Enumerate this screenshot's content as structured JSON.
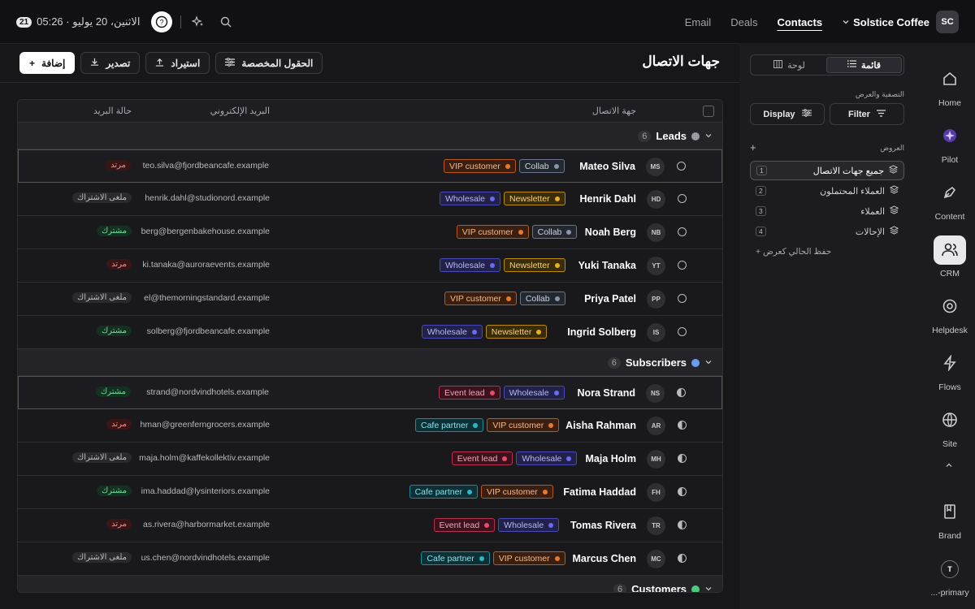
{
  "topbar": {
    "notif_count": "21",
    "date": "الاثنين، 20 يوليو · 05:26",
    "nav": [
      "Email",
      "Deals",
      "Contacts"
    ],
    "active": "Contacts",
    "workspace": "Solstice Coffee",
    "avatar": "SC"
  },
  "header": {
    "title": "جهات الاتصال",
    "add": "إضافة",
    "export": "تصدير",
    "import": "استيراد",
    "custom_fields": "الحقول المخصصة"
  },
  "table": {
    "col_contact": "جهة الاتصال",
    "col_email": "البريد الإلكتروني",
    "col_mail_status": "حالة البريد"
  },
  "groups": [
    {
      "label": "Leads",
      "count": "6",
      "color": "#9a9aa0",
      "rows": [
        {
          "initials": "MS",
          "name": "Mateo Silva",
          "tags": [
            {
              "t": "VIP customer",
              "k": "vip"
            },
            {
              "t": "Collab",
              "k": "collab"
            }
          ],
          "email": "teo.silva@fjordbeancafe.example",
          "mail": "مرتد",
          "mk": "bounced",
          "sel": true
        },
        {
          "initials": "HD",
          "name": "Henrik Dahl",
          "tags": [
            {
              "t": "Wholesale",
              "k": "wh"
            },
            {
              "t": "Newsletter",
              "k": "news"
            }
          ],
          "email": "henrik.dahl@studionord.example",
          "mail": "ملغى الاشتراك",
          "mk": "unsub"
        },
        {
          "initials": "NB",
          "name": "Noah Berg",
          "tags": [
            {
              "t": "VIP customer",
              "k": "vip"
            },
            {
              "t": "Collab",
              "k": "collab"
            }
          ],
          "email": "berg@bergenbakehouse.example",
          "mail": "مشترك",
          "mk": "sub"
        },
        {
          "initials": "YT",
          "name": "Yuki Tanaka",
          "tags": [
            {
              "t": "Wholesale",
              "k": "wh"
            },
            {
              "t": "Newsletter",
              "k": "news"
            }
          ],
          "email": "ki.tanaka@auroraevents.example",
          "mail": "مرتد",
          "mk": "bounced"
        },
        {
          "initials": "PP",
          "name": "Priya Patel",
          "tags": [
            {
              "t": "VIP customer",
              "k": "vip"
            },
            {
              "t": "Collab",
              "k": "collab"
            }
          ],
          "email": "el@themorningstandard.example",
          "mail": "ملغى الاشتراك",
          "mk": "unsub"
        },
        {
          "initials": "IS",
          "name": "Ingrid Solberg",
          "tags": [
            {
              "t": "Wholesale",
              "k": "wh"
            },
            {
              "t": "Newsletter",
              "k": "news"
            }
          ],
          "email": "solberg@fjordbeancafe.example",
          "mail": "مشترك",
          "mk": "sub"
        }
      ]
    },
    {
      "label": "Subscribers",
      "count": "6",
      "color": "#6a9cf0",
      "half": true,
      "rows": [
        {
          "initials": "NS",
          "name": "Nora Strand",
          "tags": [
            {
              "t": "Event lead",
              "k": "ev"
            },
            {
              "t": "Wholesale",
              "k": "wh"
            }
          ],
          "email": "strand@nordvindhotels.example",
          "mail": "مشترك",
          "mk": "sub",
          "sel": true
        },
        {
          "initials": "AR",
          "name": "Aisha Rahman",
          "tags": [
            {
              "t": "Cafe partner",
              "k": "cafe"
            },
            {
              "t": "VIP customer",
              "k": "vip"
            }
          ],
          "email": "hman@greenferngrocers.example",
          "mail": "مرتد",
          "mk": "bounced"
        },
        {
          "initials": "MH",
          "name": "Maja Holm",
          "tags": [
            {
              "t": "Event lead",
              "k": "ev"
            },
            {
              "t": "Wholesale",
              "k": "wh"
            }
          ],
          "email": "maja.holm@kaffekollektiv.example",
          "mail": "ملغى الاشتراك",
          "mk": "unsub"
        },
        {
          "initials": "FH",
          "name": "Fatima Haddad",
          "tags": [
            {
              "t": "Cafe partner",
              "k": "cafe"
            },
            {
              "t": "VIP customer",
              "k": "vip"
            }
          ],
          "email": "ima.haddad@lysinteriors.example",
          "mail": "مشترك",
          "mk": "sub"
        },
        {
          "initials": "TR",
          "name": "Tomas Rivera",
          "tags": [
            {
              "t": "Event lead",
              "k": "ev"
            },
            {
              "t": "Wholesale",
              "k": "wh"
            }
          ],
          "email": "as.rivera@harbormarket.example",
          "mail": "مرتد",
          "mk": "bounced"
        },
        {
          "initials": "MC",
          "name": "Marcus Chen",
          "tags": [
            {
              "t": "Cafe partner",
              "k": "cafe"
            },
            {
              "t": "VIP customer",
              "k": "vip"
            }
          ],
          "email": "us.chen@nordvindhotels.example",
          "mail": "ملغى الاشتراك",
          "mk": "unsub"
        }
      ]
    },
    {
      "label": "Customers",
      "count": "6",
      "color": "#4cc97a",
      "rows": []
    }
  ],
  "sidebar": {
    "list": "قائمة",
    "board": "لوحة",
    "filter_label": "التصفية والعرض",
    "filter": "Filter",
    "display": "Display",
    "views_label": "العروض",
    "views": [
      {
        "label": "جميع جهات الاتصال",
        "n": "1"
      },
      {
        "label": "العملاء المحتملون",
        "n": "2"
      },
      {
        "label": "العملاء",
        "n": "3"
      },
      {
        "label": "الإحالات",
        "n": "4"
      }
    ],
    "save_view": "+ حفظ الحالي كعرض"
  },
  "rail": [
    "Home",
    "Pilot",
    "Content",
    "CRM",
    "Helpdesk",
    "Flows",
    "Site",
    "Brand",
    "...-primary"
  ],
  "rail_avatar": "T",
  "colors": {
    "vip": "#e8792c",
    "collab": "#8a95a8",
    "wh": "#6a6af0",
    "news": "#e8b020",
    "ev": "#e84a6a",
    "cafe": "#2ab8c8"
  }
}
